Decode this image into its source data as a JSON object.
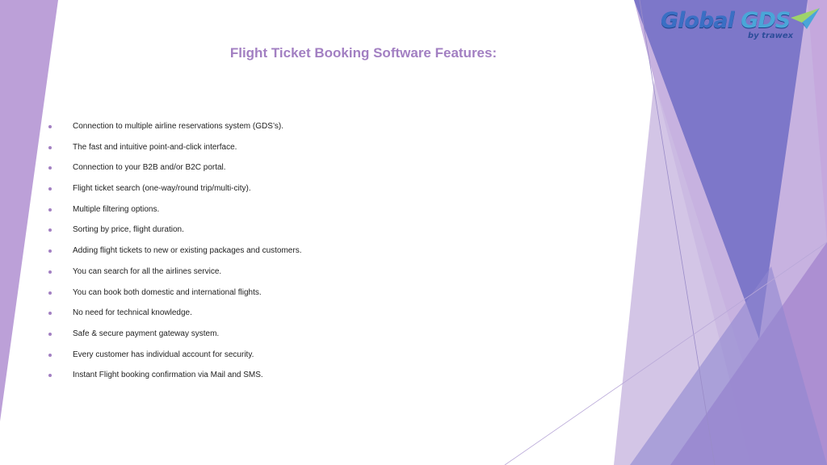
{
  "logo": {
    "primary": "Global",
    "secondary": "GDS",
    "tagline": "by trawex"
  },
  "title": "Flight Ticket Booking Software Features:",
  "features": [
    "Connection to multiple airline reservations system (GDS’s).",
    "The fast and intuitive point-and-click interface.",
    "Connection to your B2B and/or B2C portal.",
    "Flight ticket search (one-way/round trip/multi-city).",
    "Multiple filtering options.",
    "Sorting by price, flight duration.",
    "Adding flight tickets to new or existing packages and customers.",
    "You can search for all the airlines service.",
    "You can book both domestic and international flights.",
    "No need for technical knowledge.",
    "Safe & secure payment gateway system.",
    "Every customer has individual account for security.",
    "Instant Flight booking confirmation via Mail and SMS."
  ],
  "colors": {
    "accent": "#a27fc2",
    "indigo": "#6f6cc0",
    "lavender": "#c6b6dd",
    "text": "#222222",
    "logo_blue": "#3a6fc4"
  }
}
